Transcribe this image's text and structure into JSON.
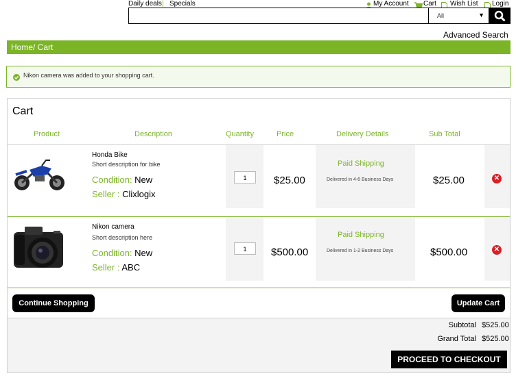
{
  "top_links": {
    "daily_deals": "Daily deals",
    "separator": "|",
    "specials": "Specials",
    "my_account": "My Account",
    "cart": "Cart",
    "wish_list": "Wish List",
    "login": "Login"
  },
  "search": {
    "value": "",
    "placeholder": "",
    "category": "All",
    "advanced": "Advanced Search"
  },
  "breadcrumb": "Home/ Cart",
  "message": "Nikon camera was added to your shopping cart.",
  "cart": {
    "title": "Cart",
    "columns": [
      "Product",
      "Description",
      "Quantity",
      "Price",
      "Delivery Details",
      "Sub Total"
    ],
    "items": [
      {
        "name": "Honda Bike",
        "description": "Short description for bike",
        "condition_label": "Condition:",
        "condition": "New",
        "seller_label": "Seller :",
        "seller": "Clixlogix",
        "quantity": "1",
        "price": "$25.00",
        "shipping": "Paid Shipping",
        "delivery": "Delivered in 4-6 Business Days",
        "subtotal": "$25.00",
        "image": "motorbike"
      },
      {
        "name": "Nikon camera",
        "description": "Short description here",
        "condition_label": "Condition:",
        "condition": "New",
        "seller_label": "Seller :",
        "seller": "ABC",
        "quantity": "1",
        "price": "$500.00",
        "shipping": "Paid Shipping",
        "delivery": "Delivered in 1-2 Business Days",
        "subtotal": "$500.00",
        "image": "camera"
      }
    ],
    "continue_label": "Continue Shopping",
    "update_label": "Update Cart",
    "subtotal_label": "Subtotal",
    "subtotal_value": "$525.00",
    "grandtotal_label": "Grand Total",
    "grandtotal_value": "$525.00",
    "checkout_label": "PROCEED TO CHECKOUT"
  },
  "colors": {
    "accent": "#7cb428",
    "remove": "#d81f26",
    "button": "#000000"
  },
  "icons": [
    "user-icon",
    "cart-icon",
    "document-icon",
    "search-icon",
    "check-circle-icon",
    "remove-icon"
  ]
}
